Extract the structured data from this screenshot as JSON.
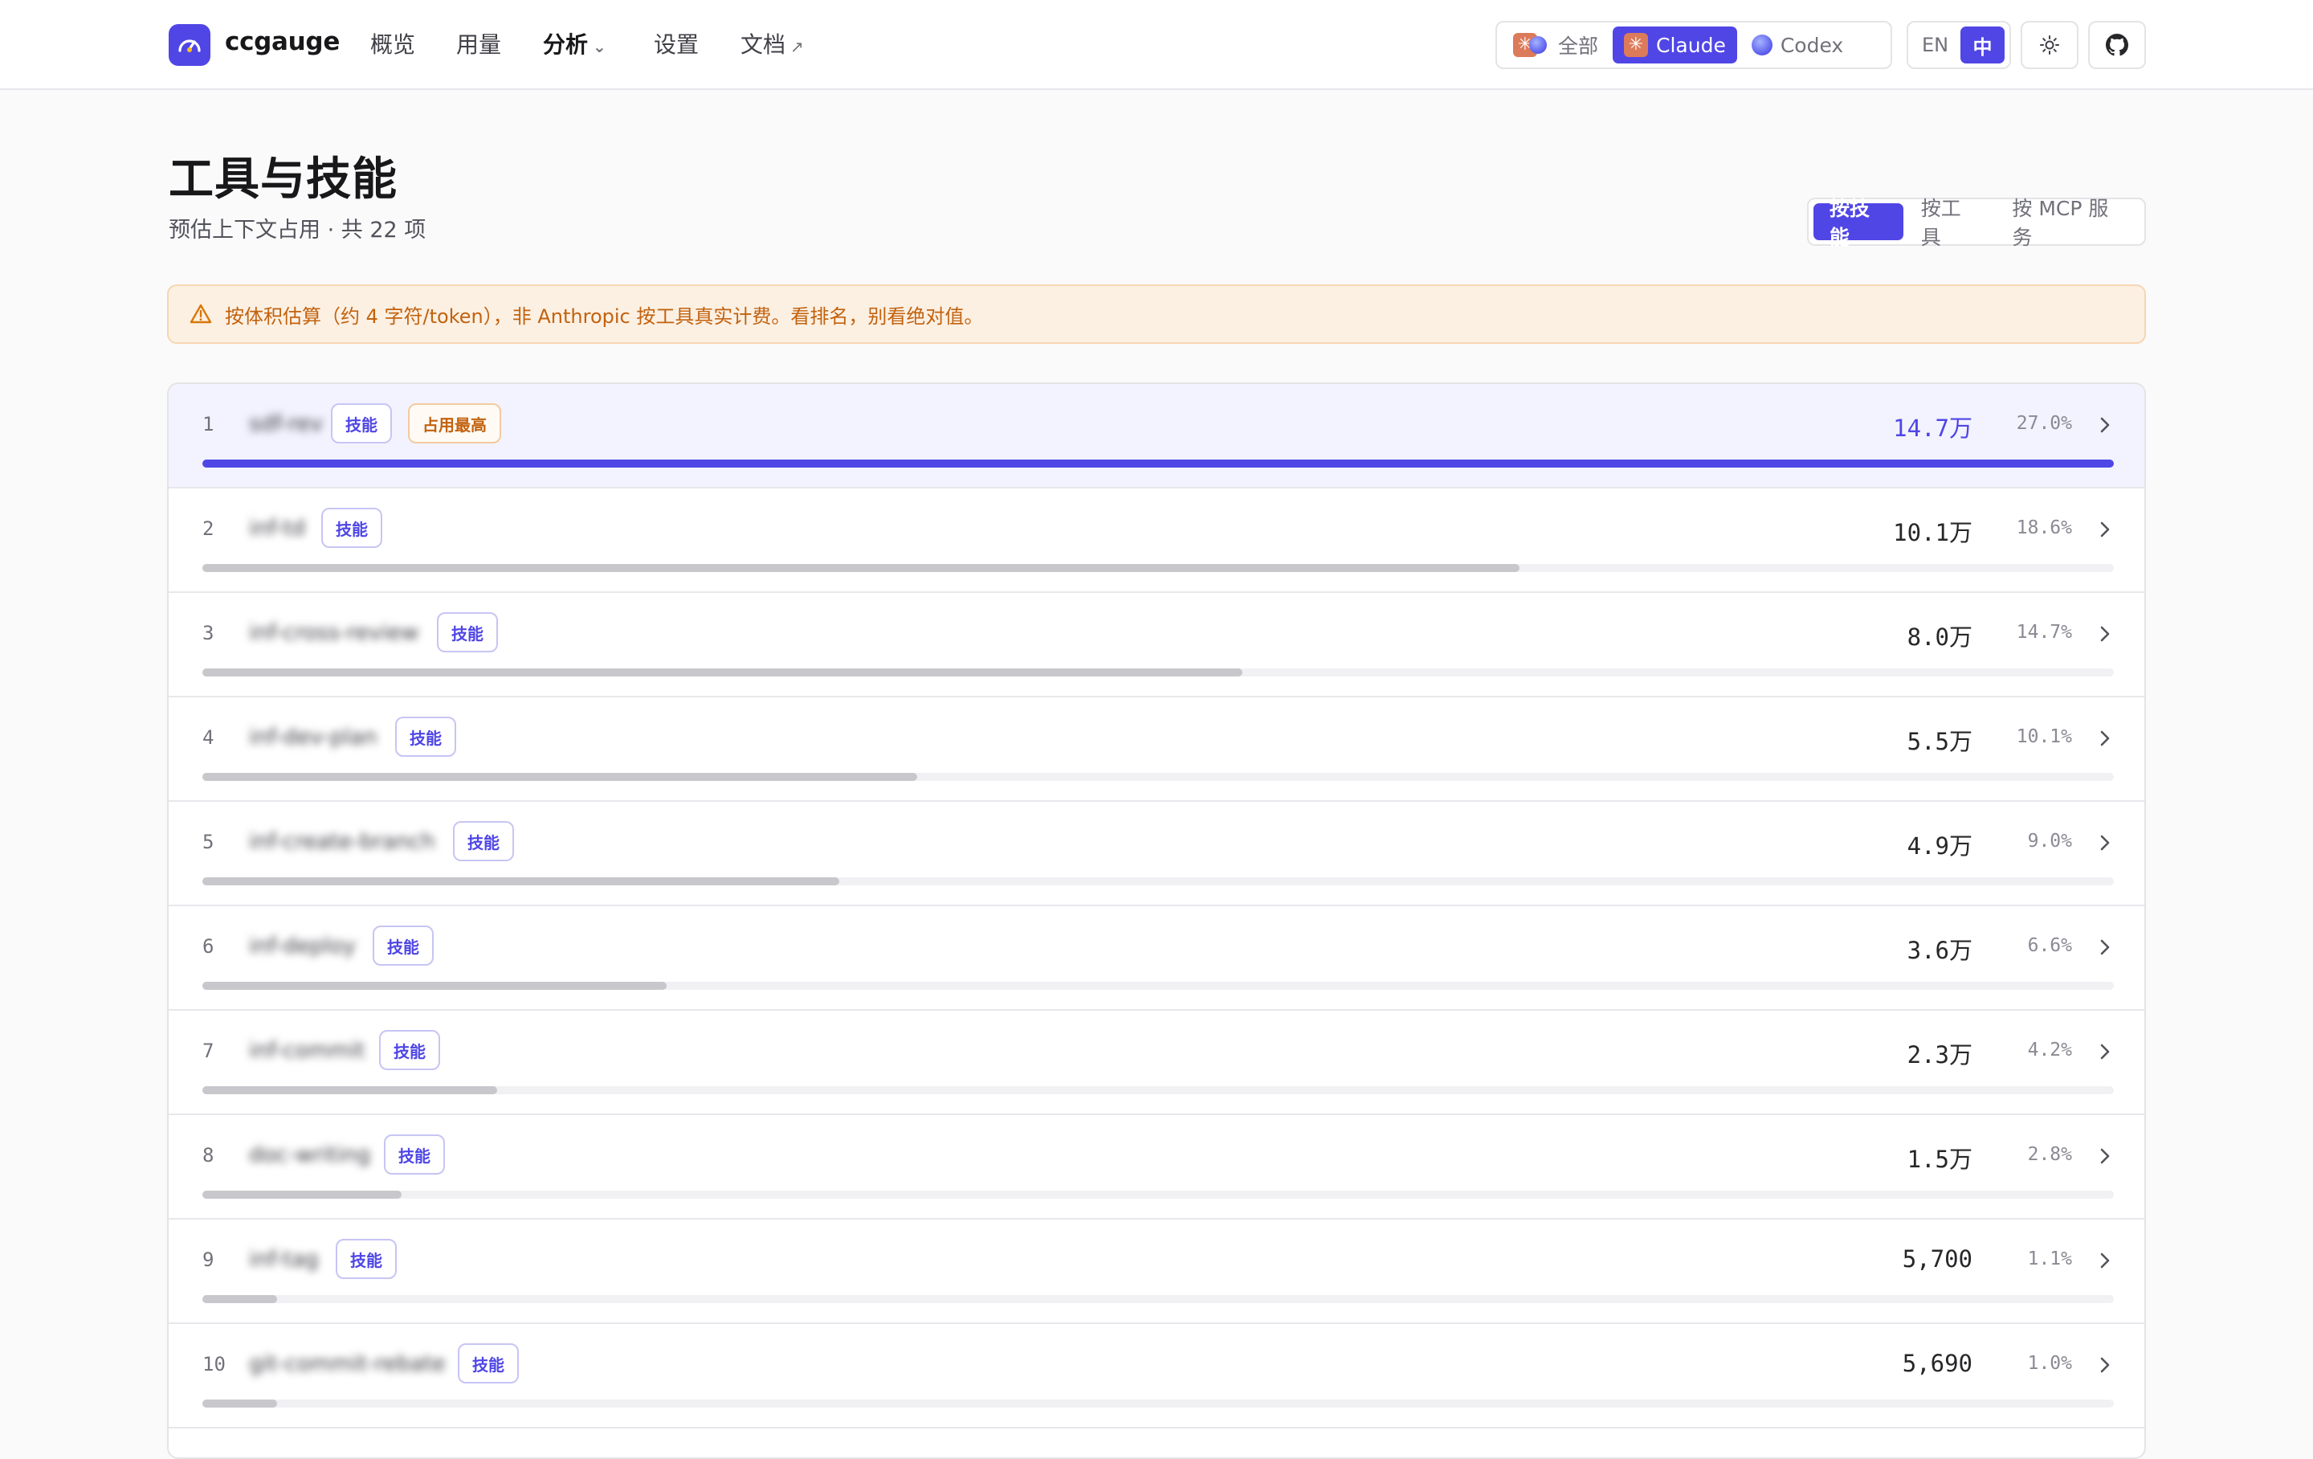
{
  "header": {
    "brand": "ccgauge",
    "nav": [
      {
        "label": "概览",
        "active": false
      },
      {
        "label": "用量",
        "active": false
      },
      {
        "label": "分析",
        "active": true,
        "dropdown": true
      },
      {
        "label": "设置",
        "active": false
      },
      {
        "label": "文档",
        "active": false,
        "external": true
      }
    ],
    "providers": [
      {
        "label": "全部",
        "icon": "claude-codex-icon",
        "active": false
      },
      {
        "label": "Claude",
        "icon": "claude-icon",
        "active": true
      },
      {
        "label": "Codex",
        "icon": "codex-icon",
        "active": false
      }
    ],
    "languages": [
      {
        "label": "EN",
        "active": false
      },
      {
        "label": "中",
        "active": true
      }
    ],
    "icons": [
      "logo-gauge-icon",
      "chevron-down-icon",
      "external-link-icon",
      "sun-icon",
      "github-icon"
    ]
  },
  "page": {
    "title": "工具与技能",
    "subtitle": "预估上下文占用 · 共 22 项",
    "view_tabs": [
      {
        "label": "按技能",
        "active": true
      },
      {
        "label": "按工具",
        "active": false
      },
      {
        "label": "按 MCP 服务",
        "active": false
      }
    ]
  },
  "warning": {
    "icon": "warning-triangle-icon",
    "text": "按体积估算（约 4 字符/token），非 Anthropic 按工具真实计费。看排名，别看绝对值。"
  },
  "colors": {
    "accent": "#5046e5",
    "warning_text": "#c2620e",
    "warning_bg": "#fcf0e3",
    "bar_gray": "#c7c7cc"
  },
  "rows": [
    {
      "rank": "1",
      "name": "sdf-rev",
      "badge": "技能",
      "badge2": "占用最高",
      "value": "14.7万",
      "pct": "27.0%",
      "share": 1.0
    },
    {
      "rank": "2",
      "name": "inf-td",
      "badge": "技能",
      "value": "10.1万",
      "pct": "18.6%",
      "share": 0.689
    },
    {
      "rank": "3",
      "name": "inf-cross-review",
      "badge": "技能",
      "value": "8.0万",
      "pct": "14.7%",
      "share": 0.544
    },
    {
      "rank": "4",
      "name": "inf-dev-plan",
      "badge": "技能",
      "value": "5.5万",
      "pct": "10.1%",
      "share": 0.374
    },
    {
      "rank": "5",
      "name": "inf-create-branch",
      "badge": "技能",
      "value": "4.9万",
      "pct": "9.0%",
      "share": 0.333
    },
    {
      "rank": "6",
      "name": "inf-deploy",
      "badge": "技能",
      "value": "3.6万",
      "pct": "6.6%",
      "share": 0.243
    },
    {
      "rank": "7",
      "name": "inf-commit",
      "badge": "技能",
      "value": "2.3万",
      "pct": "4.2%",
      "share": 0.154
    },
    {
      "rank": "8",
      "name": "doc-writing",
      "badge": "技能",
      "value": "1.5万",
      "pct": "2.8%",
      "share": 0.104
    },
    {
      "rank": "9",
      "name": "inf-tag",
      "badge": "技能",
      "value": "5,700",
      "pct": "1.1%",
      "share": 0.039
    },
    {
      "rank": "10",
      "name": "git-commit-rebate",
      "badge": "技能",
      "value": "5,690",
      "pct": "1.0%",
      "share": 0.039
    }
  ]
}
